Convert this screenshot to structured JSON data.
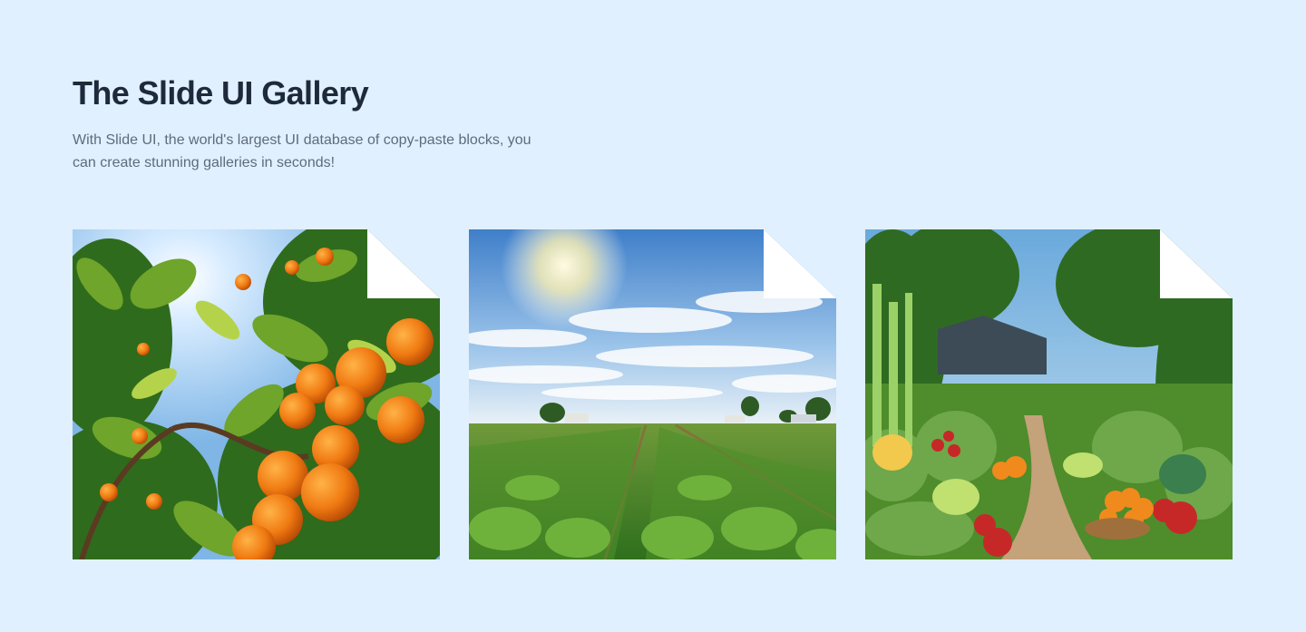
{
  "header": {
    "title": "The Slide UI Gallery",
    "subtitle": "With Slide UI, the world's largest UI database of copy-paste blocks, you can create stunning galleries in seconds!"
  },
  "gallery": {
    "items": [
      {
        "image": "orange-tree-image"
      },
      {
        "image": "farm-field-image"
      },
      {
        "image": "vegetable-garden-image"
      }
    ]
  },
  "colors": {
    "background": "#e0f0fe",
    "title": "#1e2a3b",
    "subtitle": "#5f6b7d",
    "fold": "#ffffff"
  }
}
